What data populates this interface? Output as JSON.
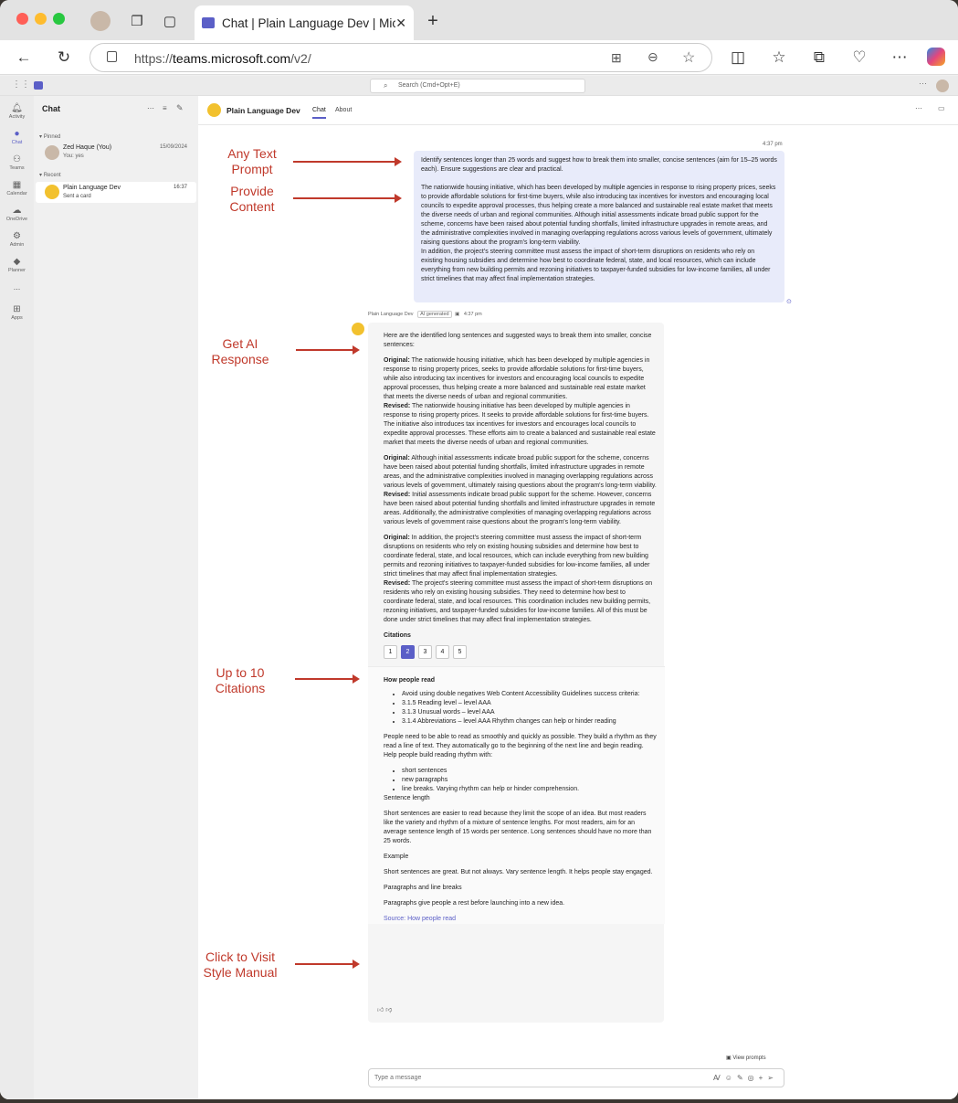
{
  "browser": {
    "tab_title": "Chat | Plain Language Dev | Mic",
    "url_prefix": "https://",
    "url_host": "teams.microsoft.com",
    "url_path": "/v2/"
  },
  "teams": {
    "search_placeholder": "Search (Cmd+Opt+E)",
    "rail": [
      "Activity",
      "Chat",
      "Teams",
      "Calendar",
      "OneDrive",
      "Admin",
      "Planner",
      "...",
      "Apps"
    ],
    "chat_header": "Chat",
    "pinned_label": "Pinned",
    "recent_label": "Recent",
    "conversations": [
      {
        "name": "Zed Haque (You)",
        "preview": "You: yes",
        "time": "15/09/2024"
      },
      {
        "name": "Plain Language Dev",
        "preview": "Sent a card",
        "time": "16:37"
      }
    ],
    "channel": {
      "title": "Plain Language Dev",
      "tab_chat": "Chat",
      "tab_about": "About"
    },
    "user_msg": {
      "time": "4:37 pm",
      "prompt": "Identify sentences longer than 25 words and suggest how to break them into smaller, concise sentences (aim for 15–25 words each). Ensure suggestions are clear and practical.",
      "content1": "The nationwide housing initiative, which has been developed by multiple agencies in response to rising property prices, seeks to provide affordable solutions for first-time buyers, while also introducing tax incentives for investors and encouraging local councils to expedite approval processes, thus helping create a more balanced and sustainable real estate market that meets the diverse needs of urban and regional communities. Although initial assessments indicate broad public support for the scheme, concerns have been raised about potential funding shortfalls, limited infrastructure upgrades in remote areas, and the administrative complexities involved in managing overlapping regulations across various levels of government, ultimately raising questions about the program's long-term viability.",
      "content2": "In addition, the project's steering committee must assess the impact of short-term disruptions on residents who rely on existing housing subsidies and determine how best to coordinate federal, state, and local resources, which can include everything from new building permits and rezoning initiatives to taxpayer-funded subsidies for low-income families, all under strict timelines that may affect final implementation strategies."
    },
    "bot_msg": {
      "sender": "Plain Language Dev",
      "badge": "AI generated",
      "time": "4:37 pm",
      "intro": "Here are the identified long sentences and suggested ways to break them into smaller, concise sentences:",
      "label_original": "Original:",
      "label_revised": "Revised:",
      "pairs": [
        {
          "original": "The nationwide housing initiative, which has been developed by multiple agencies in response to rising property prices, seeks to provide affordable solutions for first-time buyers, while also introducing tax incentives for investors and encouraging local councils to expedite approval processes, thus helping create a more balanced and sustainable real estate market that meets the diverse needs of urban and regional communities.",
          "revised": "The nationwide housing initiative has been developed by multiple agencies in response to rising property prices. It seeks to provide affordable solutions for first-time buyers. The initiative also introduces tax incentives for investors and encourages local councils to expedite approval processes. These efforts aim to create a balanced and sustainable real estate market that meets the diverse needs of urban and regional communities."
        },
        {
          "original": "Although initial assessments indicate broad public support for the scheme, concerns have been raised about potential funding shortfalls, limited infrastructure upgrades in remote areas, and the administrative complexities involved in managing overlapping regulations across various levels of government, ultimately raising questions about the program's long-term viability.",
          "revised": "Initial assessments indicate broad public support for the scheme. However, concerns have been raised about potential funding shortfalls and limited infrastructure upgrades in remote areas. Additionally, the administrative complexities of managing overlapping regulations across various levels of government raise questions about the program's long-term viability."
        },
        {
          "original": "In addition, the project's steering committee must assess the impact of short-term disruptions on residents who rely on existing housing subsidies and determine how best to coordinate federal, state, and local resources, which can include everything from new building permits and rezoning initiatives to taxpayer-funded subsidies for low-income families, all under strict timelines that may affect final implementation strategies.",
          "revised": "The project's steering committee must assess the impact of short-term disruptions on residents who rely on existing housing subsidies. They need to determine how best to coordinate federal, state, and local resources. This coordination includes new building permits, rezoning initiatives, and taxpayer-funded subsidies for low-income families. All of this must be done under strict timelines that may affect final implementation strategies."
        }
      ],
      "citations_label": "Citations",
      "citations": [
        "1",
        "2",
        "3",
        "4",
        "5"
      ],
      "card": {
        "title": "How people read",
        "bullets": [
          "Avoid using double negatives Web Content Accessibility Guidelines success criteria:",
          "3.1.5 Reading level – level AAA",
          "3.1.3 Unusual words – level AAA",
          "3.1.4 Abbreviations – level AAA Rhythm changes can help or hinder reading"
        ],
        "p1": "People need to be able to read as smoothly and quickly as possible. They build a rhythm as they read a line of text. They automatically go to the beginning of the next line and begin reading. Help people build reading rhythm with:",
        "bullets2": [
          "short sentences",
          "new paragraphs",
          "line breaks. Varying rhythm can help or hinder comprehension."
        ],
        "h2": "Sentence length",
        "p2": "Short sentences are easier to read because they limit the scope of an idea. But most readers like the variety and rhythm of a mixture of sentence lengths. For most readers, aim for an average sentence length of 15 words per sentence. Long sentences should have no more than 25 words.",
        "h3": "Example",
        "p3": "Short sentences are great. But not always. Vary sentence length. It helps people stay engaged.",
        "h4": "Paragraphs and line breaks",
        "p4": "Paragraphs give people a rest before launching into a new idea.",
        "source": "Source: How people read"
      }
    },
    "view_prompts": "View prompts",
    "compose_placeholder": "Type a message"
  },
  "annotations": [
    {
      "text": "Any Text\nPrompt"
    },
    {
      "text": "Provide\nContent"
    },
    {
      "text": "Get AI\nResponse"
    },
    {
      "text": "Up to 10\nCitations"
    },
    {
      "text": "Click to Visit\nStyle Manual"
    }
  ],
  "colors": {
    "annotation": "#c0392b",
    "brand": "#5b5fc7",
    "bubble": "#e8ebfa"
  }
}
